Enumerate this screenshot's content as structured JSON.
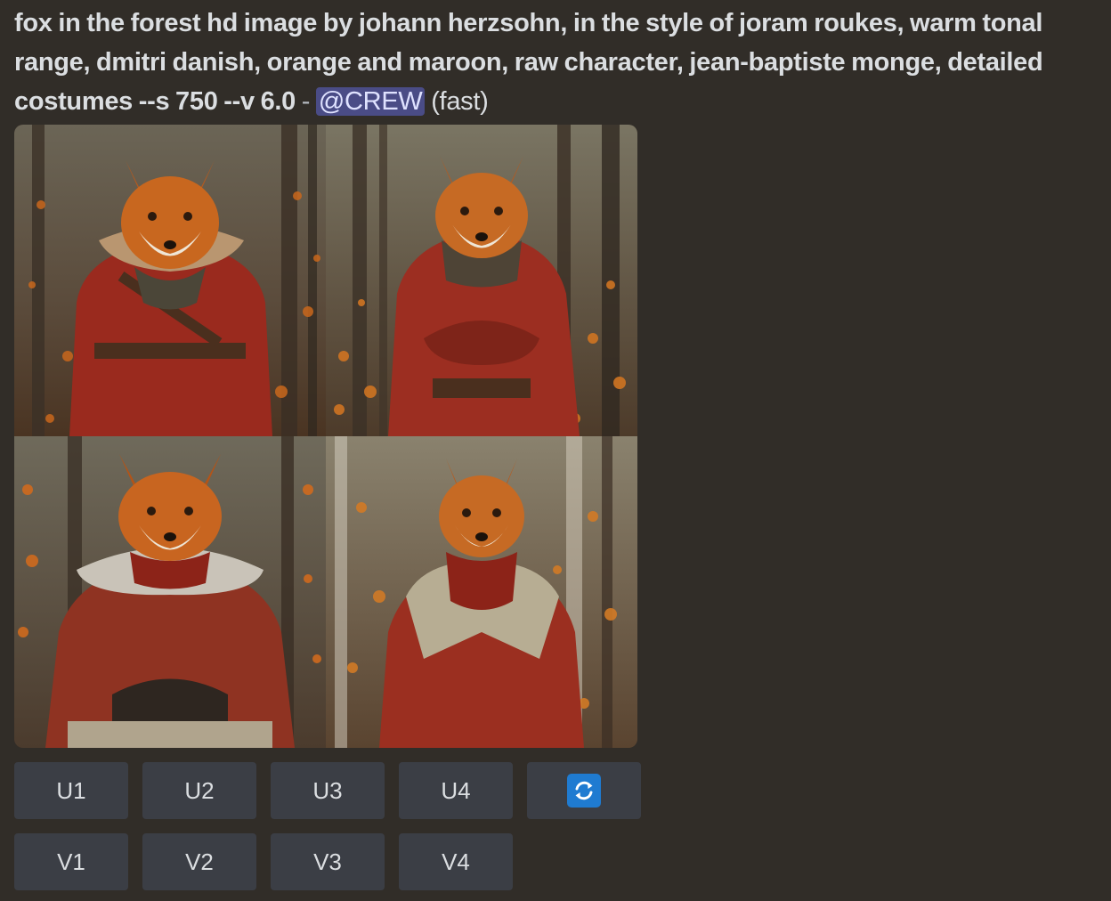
{
  "message": {
    "prompt_text": "fox in the forest hd image by johann herzsohn, in the style of joram roukes, warm tonal range, dmitri danish, orange and maroon, raw character, jean-baptiste monge, detailed costumes --s 750 --v 6.0",
    "separator": "-",
    "mention": "@CREW",
    "mode": "(fast)"
  },
  "image_grid": {
    "tiles": [
      {
        "icon": "fox-portrait-red-coat-fur-collar"
      },
      {
        "icon": "fox-portrait-red-coat-arms-crossed"
      },
      {
        "icon": "fox-portrait-red-jacket-sitting"
      },
      {
        "icon": "fox-portrait-beige-jacket-red-scarf"
      }
    ]
  },
  "buttons": {
    "upscale": [
      "U1",
      "U2",
      "U3",
      "U4"
    ],
    "variation": [
      "V1",
      "V2",
      "V3",
      "V4"
    ],
    "reroll_icon": "refresh-icon"
  },
  "colors": {
    "background": "#312d28",
    "button": "#3b3e45",
    "mention_bg": "#4a4c86",
    "reroll_accent": "#1f7bd1"
  }
}
